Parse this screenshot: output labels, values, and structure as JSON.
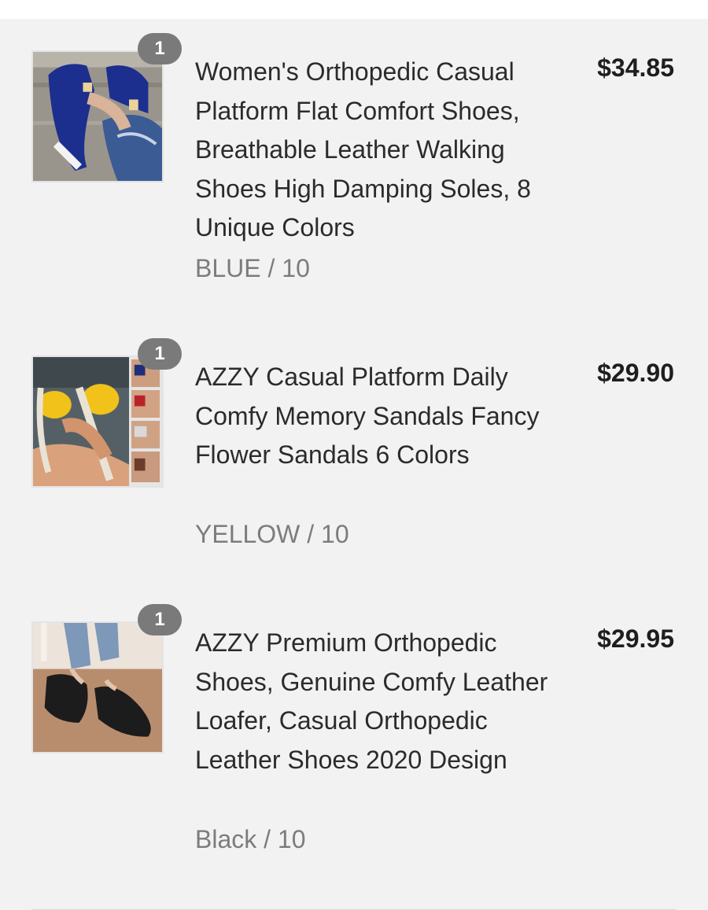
{
  "cart": {
    "items": [
      {
        "quantity": "1",
        "title": "Women's Orthopedic Casual Platform Flat Comfort Shoes, Breathable Leather Walking Shoes High Damping Soles, 8 Unique Colors",
        "variant": "BLUE / 10",
        "price": "$34.85",
        "image": "blue-platform-sandal-photo"
      },
      {
        "quantity": "1",
        "title": "AZZY Casual Platform Daily Comfy Memory Sandals Fancy Flower Sandals 6 Colors",
        "variant": "YELLOW / 10",
        "price": "$29.90",
        "image": "yellow-bow-sandal-photo"
      },
      {
        "quantity": "1",
        "title": "AZZY Premium Orthopedic Shoes, Genuine Comfy Leather Loafer, Casual Orthopedic Leather Shoes 2020 Design",
        "variant": "Black / 10",
        "price": "$29.95",
        "image": "black-loafer-photo"
      }
    ]
  },
  "colors": {
    "panel_bg": "#f2f2f2",
    "badge_bg": "#7a7a7a",
    "title_text": "#2b2b2b",
    "variant_text": "#7c7c7c",
    "price_text": "#1e1e1e"
  }
}
